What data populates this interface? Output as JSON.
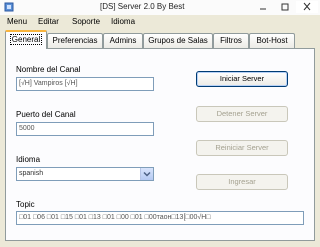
{
  "window": {
    "title": "[DS] Server 2.0 By Best"
  },
  "menu": [
    "Menu",
    "Editar",
    "Soporte",
    "Idioma"
  ],
  "tabs": [
    "General",
    "Preferencias",
    "Admins",
    "Grupos de Salas",
    "Filtros",
    "Bot-Host"
  ],
  "active_tab": "General",
  "general": {
    "channel_name_label": "Nombre del Canal",
    "channel_name_value": "[√H] Vampiros [√H]",
    "port_label": "Puerto del Canal",
    "port_value": "5000",
    "language_label": "Idioma",
    "language_value": "spanish",
    "topic_label": "Topic",
    "topic_value": "□01 □06 □01 □15 □01 □13 □01 □00 □01 □00таон□13[□00√H□"
  },
  "buttons": {
    "start": "Iniciar Server",
    "stop": "Detener Server",
    "restart": "Reiniciar Server",
    "enter": "Ingresar"
  },
  "button_states": {
    "start": "enabled",
    "stop": "disabled",
    "restart": "disabled",
    "enter": "disabled"
  },
  "icons": {
    "app": "server-app-icon",
    "select_arrow": "chevron-down-icon",
    "minimize": "minimize-icon",
    "maximize": "maximize-icon",
    "close": "close-icon"
  },
  "colors": {
    "tab_highlight": "#f9b43c",
    "input_border": "#7f9db9",
    "panel_bg": "#fcfcfe"
  }
}
